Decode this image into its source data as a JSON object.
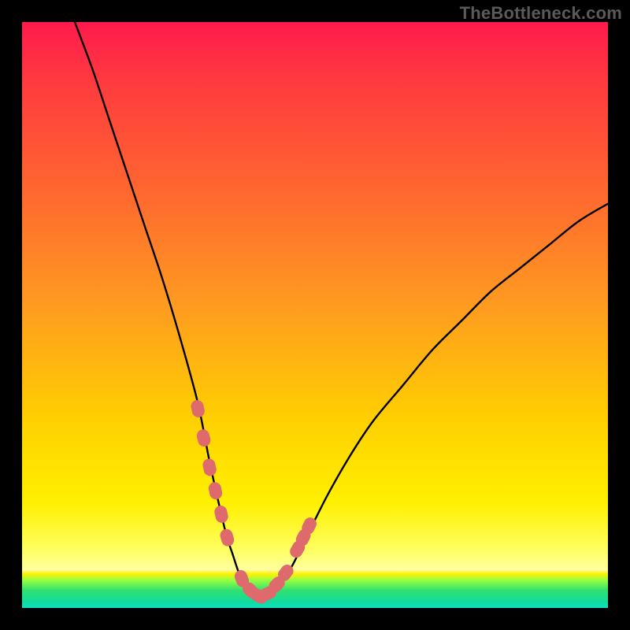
{
  "watermark": {
    "text": "TheBottleneck.com"
  },
  "colors": {
    "curve_stroke": "#000000",
    "marker_fill": "#de6a6e",
    "background_frame": "#000000"
  },
  "chart_data": {
    "type": "line",
    "title": "",
    "xlabel": "",
    "ylabel": "",
    "xlim": [
      0,
      100
    ],
    "ylim": [
      0,
      100
    ],
    "grid": false,
    "legend": false,
    "series": [
      {
        "name": "bottleneck-curve",
        "x": [
          9,
          12,
          15,
          18,
          21,
          24,
          27,
          30,
          32,
          34,
          35,
          36,
          37,
          38,
          39,
          40,
          41,
          42,
          43,
          44,
          46,
          48,
          52,
          56,
          60,
          65,
          70,
          75,
          80,
          85,
          90,
          95,
          100
        ],
        "y": [
          100,
          92,
          83,
          74,
          65,
          56,
          46,
          35,
          25,
          16,
          12,
          9,
          6,
          4,
          3,
          2,
          2,
          2,
          3,
          4,
          7,
          11,
          19,
          26,
          32,
          38,
          44,
          49,
          54,
          58,
          62,
          66,
          69
        ]
      }
    ],
    "markers": [
      {
        "name": "left-segment-1",
        "x": 30.0,
        "y": 34
      },
      {
        "name": "left-segment-2",
        "x": 31.0,
        "y": 29
      },
      {
        "name": "left-segment-3",
        "x": 32.0,
        "y": 24
      },
      {
        "name": "left-segment-4",
        "x": 33.0,
        "y": 20
      },
      {
        "name": "left-segment-5",
        "x": 34.0,
        "y": 16
      },
      {
        "name": "left-segment-6",
        "x": 35.0,
        "y": 12
      },
      {
        "name": "bottom-1",
        "x": 37.5,
        "y": 5
      },
      {
        "name": "bottom-2",
        "x": 39.0,
        "y": 3
      },
      {
        "name": "bottom-3",
        "x": 40.5,
        "y": 2
      },
      {
        "name": "bottom-4",
        "x": 42.0,
        "y": 2.5
      },
      {
        "name": "bottom-5",
        "x": 43.5,
        "y": 4
      },
      {
        "name": "bottom-6",
        "x": 45.0,
        "y": 6
      },
      {
        "name": "right-segment-1",
        "x": 47.0,
        "y": 10
      },
      {
        "name": "right-segment-2",
        "x": 48.0,
        "y": 12
      },
      {
        "name": "right-segment-3",
        "x": 49.0,
        "y": 14
      }
    ]
  }
}
